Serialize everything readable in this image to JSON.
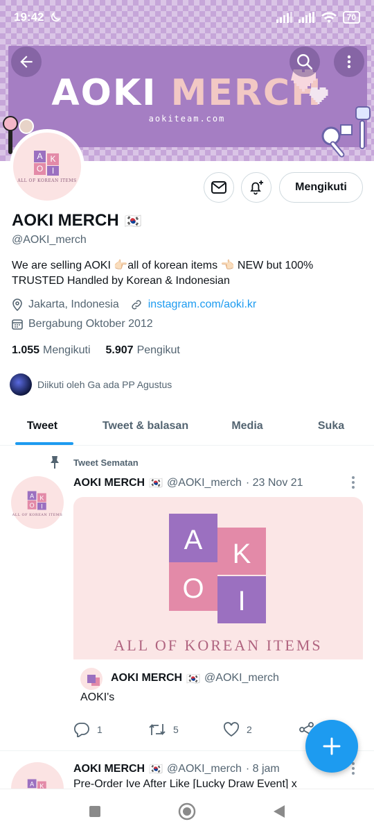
{
  "status_bar": {
    "time": "19:42",
    "battery": "70"
  },
  "banner": {
    "title_white": "AOKI",
    "title_pink": "MERCH",
    "subtitle": "aokiteam.com"
  },
  "logo": {
    "letters": [
      "A",
      "K",
      "O",
      "I"
    ],
    "tagline": "ALL OF KOREAN ITEMS",
    "colors": {
      "purple": "#9b70c0",
      "pink": "#e38aa8"
    }
  },
  "profile": {
    "follow_button": "Mengikuti",
    "name": "AOKI MERCH",
    "flag": "🇰🇷",
    "handle": "@AOKI_merch",
    "bio_line1": "We are selling AOKI 👉🏻all of korean items 👈🏻 NEW but 100%",
    "bio_line2": "TRUSTED Handled by Korean & Indonesian",
    "location": "Jakarta, Indonesia",
    "link": "instagram.com/aoki.kr",
    "joined": "Bergabung Oktober 2012",
    "following_count": "1.055",
    "following_label": "Mengikuti",
    "followers_count": "5.907",
    "followers_label": "Pengikut",
    "followed_by": "Diikuti oleh Ga ada PP Agustus"
  },
  "tabs": [
    "Tweet",
    "Tweet & balasan",
    "Media",
    "Suka"
  ],
  "pinned_tweet": {
    "pinned_label": "Tweet Sematan",
    "name": "AOKI MERCH",
    "flag": "🇰🇷",
    "handle": "@AOKI_merch",
    "date": "· 23 Nov 21",
    "media_tagline": "ALL OF KOREAN ITEMS",
    "quote_name": "AOKI MERCH",
    "quote_flag": "🇰🇷",
    "quote_handle": "@AOKI_merch",
    "quote_text": "AOKI's",
    "replies": "1",
    "retweets": "5",
    "likes": "2"
  },
  "second_tweet": {
    "name": "AOKI MERCH",
    "flag": "🇰🇷",
    "handle": "@AOKI_merch",
    "date": "· 8 jam",
    "text": "Pre-Order Ive After Like [Lucky Draw Event] x"
  },
  "colors": {
    "accent": "#1d9bf0",
    "banner": "#a57ec3"
  }
}
